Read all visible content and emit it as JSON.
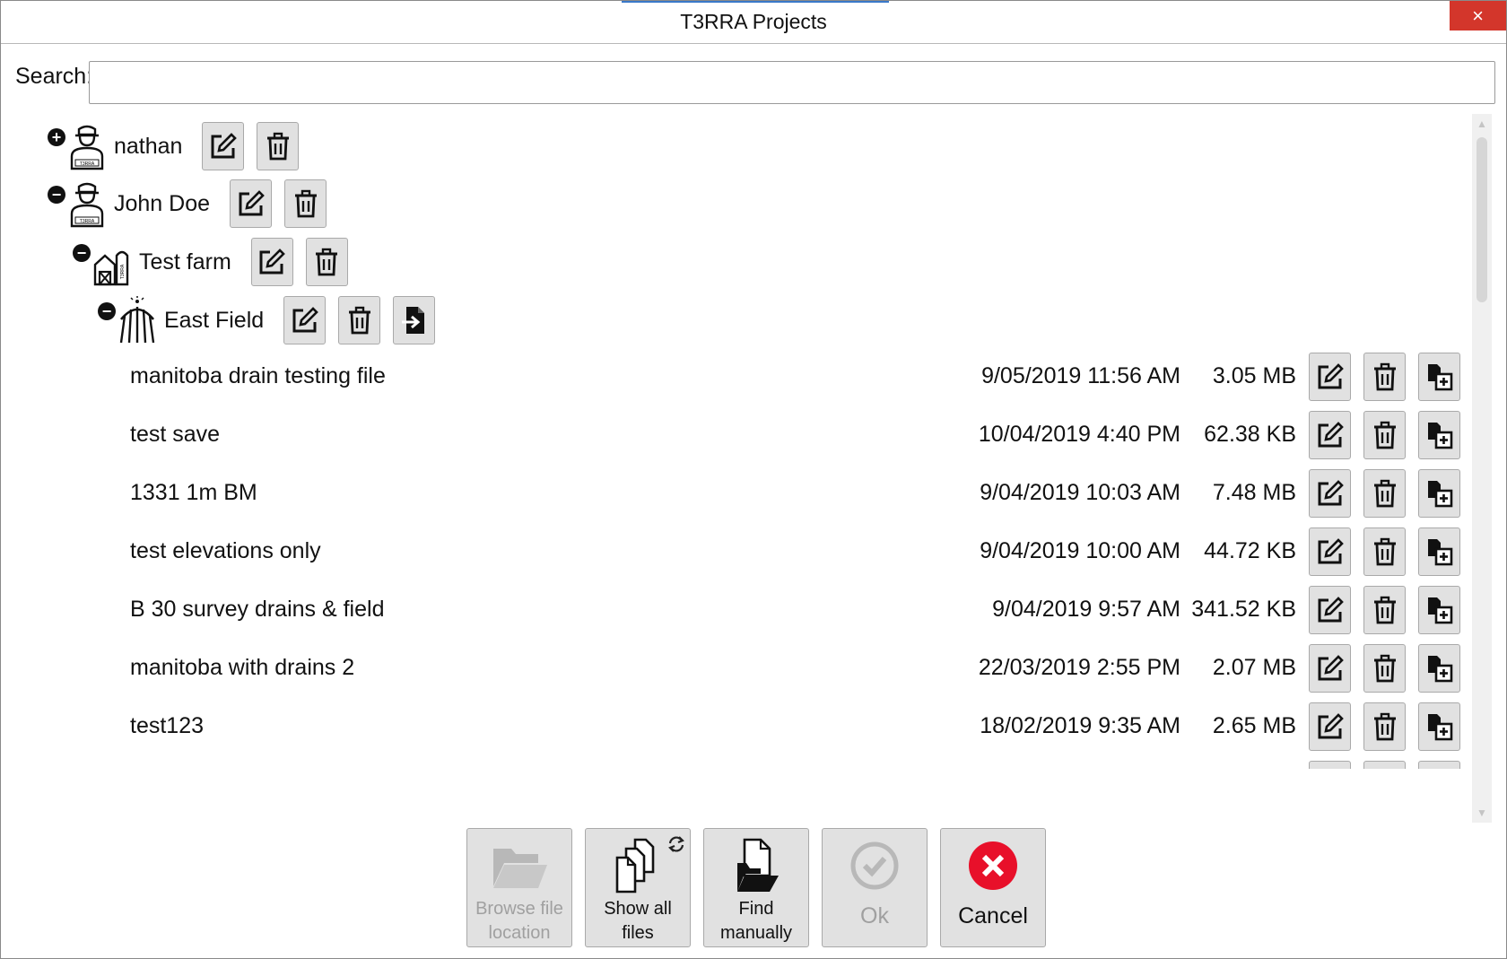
{
  "window": {
    "title": "T3RRA Projects",
    "close_glyph": "×",
    "accent_color": "#3a78c9",
    "close_color": "#d3362b"
  },
  "search": {
    "label": "Search:",
    "value": "",
    "placeholder": ""
  },
  "tree": {
    "nodes": [
      {
        "label": "nathan",
        "expander": "+",
        "icon": "farmer-icon",
        "actions": [
          "edit-icon",
          "delete-icon"
        ]
      },
      {
        "label": "John Doe",
        "expander": "−",
        "icon": "farmer-icon",
        "actions": [
          "edit-icon",
          "delete-icon"
        ]
      },
      {
        "label": "Test farm",
        "expander": "−",
        "icon": "farm-barn-icon",
        "actions": [
          "edit-icon",
          "delete-icon"
        ]
      },
      {
        "label": "East Field",
        "expander": "−",
        "icon": "field-pivot-icon",
        "actions": [
          "edit-icon",
          "delete-icon",
          "import-file-icon"
        ]
      }
    ],
    "files": [
      {
        "name": "manitoba drain testing file",
        "date": "9/05/2019 11:56 AM",
        "size": "3.05 MB"
      },
      {
        "name": "test save",
        "date": "10/04/2019 4:40 PM",
        "size": "62.38 KB"
      },
      {
        "name": "1331 1m BM",
        "date": "9/04/2019 10:03 AM",
        "size": "7.48 MB"
      },
      {
        "name": "test elevations only",
        "date": "9/04/2019 10:00 AM",
        "size": "44.72 KB"
      },
      {
        "name": "B 30 survey drains & field",
        "date": "9/04/2019 9:57 AM",
        "size": "341.52 KB"
      },
      {
        "name": "manitoba with drains 2",
        "date": "22/03/2019 2:55 PM",
        "size": "2.07 MB"
      },
      {
        "name": "test123",
        "date": "18/02/2019 9:35 AM",
        "size": "2.65 MB"
      }
    ],
    "file_actions": [
      "edit-icon",
      "delete-icon",
      "copy-file-icon"
    ]
  },
  "buttons": {
    "browse": {
      "label": "Browse file\nlocation",
      "icon": "folder-icon",
      "enabled": false
    },
    "show_all": {
      "label": "Show all\nfiles",
      "icon": "files-icon",
      "enabled": true
    },
    "find": {
      "label": "Find\nmanually",
      "icon": "find-folder-icon",
      "enabled": true
    },
    "ok": {
      "label": "Ok",
      "icon": "check-circle-icon",
      "enabled": false
    },
    "cancel": {
      "label": "Cancel",
      "icon": "cancel-circle-icon",
      "enabled": true,
      "icon_color": "#e8102a"
    }
  }
}
